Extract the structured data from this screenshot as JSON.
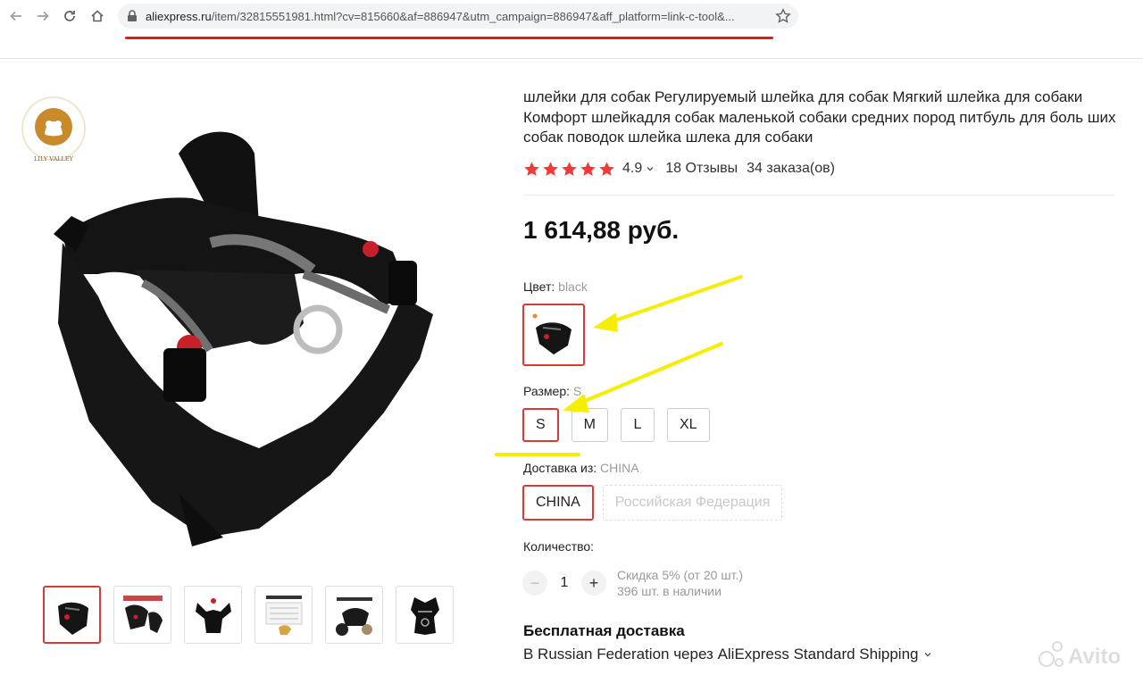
{
  "browser": {
    "url_host": "aliexpress.ru",
    "url_path": "/item/32815551981.html?cv=815660&af=886947&utm_campaign=886947&aff_platform=link-c-tool&..."
  },
  "brand": {
    "logo_text": "LILY VALLEY"
  },
  "product": {
    "title": "шлейки для собак Регулируемый шлейка для собак Мягкий шлейка для собаки Комфорт шлейкадля собак маленькой собаки средних пород питбуль для боль ших собак поводок шлейка шлека для собаки",
    "rating": "4.9",
    "reviews": "18 Отзывы",
    "orders": "34 заказа(ов)",
    "price": "1 614,88 руб."
  },
  "color": {
    "label": "Цвет:",
    "value": "black"
  },
  "size": {
    "label": "Размер:",
    "value": "S",
    "options": [
      "S",
      "M",
      "L",
      "XL"
    ]
  },
  "shipping_from": {
    "label": "Доставка из:",
    "value": "CHINA",
    "options": [
      "CHINA",
      "Российская Федерация"
    ]
  },
  "quantity": {
    "label": "Количество:",
    "value": "1",
    "minus": "−",
    "plus": "+",
    "discount": "Скидка 5% (от 20 шт.)",
    "stock": "396 шт. в наличии"
  },
  "delivery": {
    "free_label": "Бесплатная доставка",
    "via": "В Russian Federation через AliExpress Standard Shipping"
  },
  "watermark": "Avito",
  "colors": {
    "accent_red": "#d63a3a",
    "star_red": "#f23a3a",
    "annotation_yellow": "#f5ee00"
  }
}
